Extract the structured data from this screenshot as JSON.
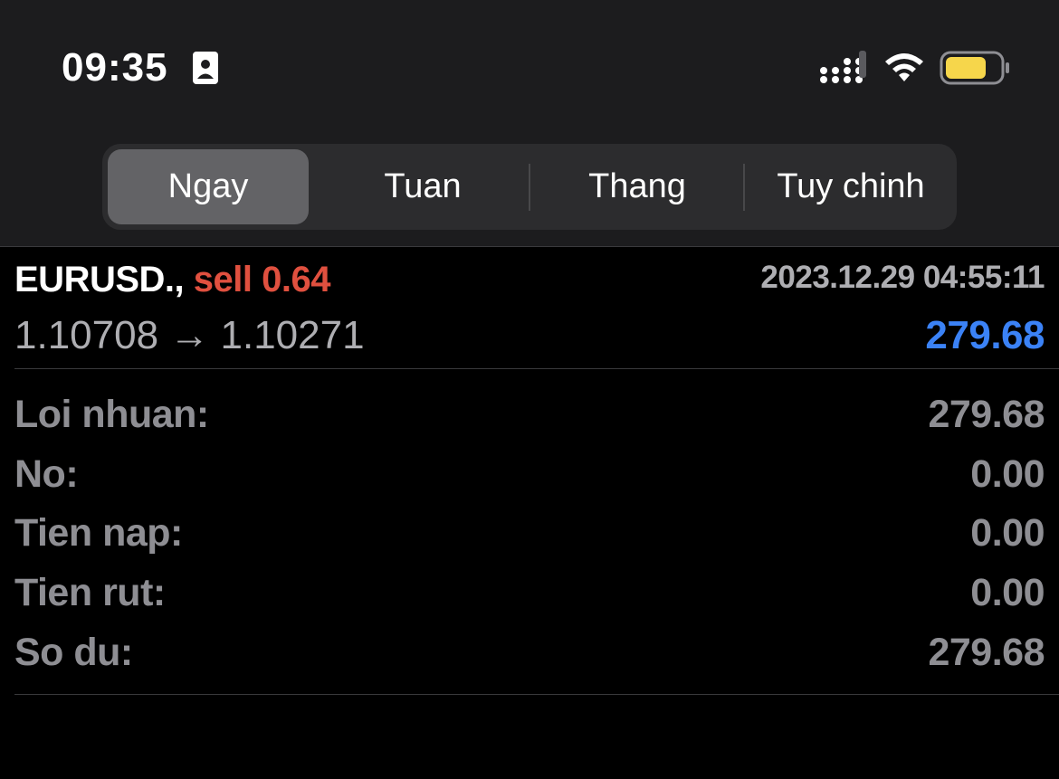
{
  "status_bar": {
    "time": "09:35",
    "icons": [
      "contact-card-icon",
      "cellular-signal-icon",
      "wifi-icon",
      "battery-icon"
    ],
    "battery_color": "#f6d64b"
  },
  "segments": {
    "items": [
      {
        "label": "Ngay",
        "active": true
      },
      {
        "label": "Tuan",
        "active": false
      },
      {
        "label": "Thang",
        "active": false
      },
      {
        "label": "Tuy chinh",
        "active": false
      }
    ]
  },
  "trade": {
    "symbol": "EURUSD.,",
    "side": "sell 0.64",
    "time": "2023.12.29 04:55:11",
    "prices": "1.10708 → 1.10271",
    "profit": "279.68",
    "side_color": "#e0503f",
    "profit_color": "#3b82f6"
  },
  "summary": [
    {
      "label": "Loi nhuan:",
      "value": "279.68"
    },
    {
      "label": "No:",
      "value": "0.00"
    },
    {
      "label": "Tien nap:",
      "value": "0.00"
    },
    {
      "label": "Tien rut:",
      "value": "0.00"
    },
    {
      "label": "So du:",
      "value": "279.68"
    }
  ]
}
